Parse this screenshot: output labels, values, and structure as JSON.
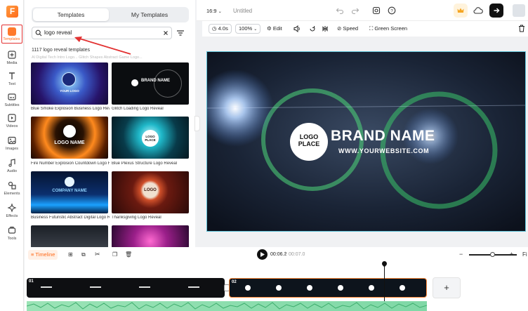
{
  "rail": {
    "items": [
      {
        "label": "Templates",
        "icon": "templates-icon"
      },
      {
        "label": "Media",
        "icon": "media-icon"
      },
      {
        "label": "Text",
        "icon": "text-icon"
      },
      {
        "label": "Subtitles",
        "icon": "subtitles-icon"
      },
      {
        "label": "Videos",
        "icon": "videos-icon"
      },
      {
        "label": "Images",
        "icon": "images-icon"
      },
      {
        "label": "Audio",
        "icon": "audio-icon"
      },
      {
        "label": "Elements",
        "icon": "elements-icon"
      },
      {
        "label": "Effects",
        "icon": "effects-icon"
      },
      {
        "label": "Tools",
        "icon": "tools-icon"
      }
    ]
  },
  "panel": {
    "tabs": [
      "Templates",
      "My Templates"
    ],
    "search_value": "logo reveal",
    "result_count": "1117 logo reveal templates",
    "ghost_row": "Al Digital Tech Intro Logo...     Glitch Shapes Abstract Game Logo...",
    "templates": [
      {
        "caption": "Blue Smoke Explosion Business Logo Reveal",
        "thumb_text": "YOUR LOGO"
      },
      {
        "caption": "Glitch Loading Logo Reveal",
        "thumb_text": "BRAND NAME"
      },
      {
        "caption": "Fire Number Explosion Countdown Logo Reveal",
        "thumb_text": "LOGO NAME"
      },
      {
        "caption": "Blue Plexus Structure Logo Reveal",
        "thumb_text": "LOGO PLACE"
      },
      {
        "caption": "Business Futuristic Abstract Digital Logo Reveal",
        "thumb_text": "COMPANY NAME"
      },
      {
        "caption": "Thanksgiving Logo Reveal",
        "thumb_text": "LOGO"
      }
    ]
  },
  "topbar": {
    "aspect": "16:9",
    "title": "Untitled"
  },
  "toolbar": {
    "duration": "4.0s",
    "zoom": "100%",
    "edit": "Edit",
    "speed": "Speed",
    "green_screen": "Green Screen"
  },
  "canvas": {
    "logo_line1": "LOGO",
    "logo_line2": "PLACE",
    "brand": "BRAND NAME",
    "website": "WWW.YOURWEBSITE.COM"
  },
  "timeline": {
    "label": "Timeline",
    "current_time": "00:06.2",
    "total_time": "00:07.0",
    "clips": [
      "01",
      "02"
    ],
    "fit_label": "Fi"
  },
  "colors": {
    "accent": "#ff6a1a",
    "canvas_border": "#5ec3d9",
    "annotation_red": "#e23131"
  }
}
